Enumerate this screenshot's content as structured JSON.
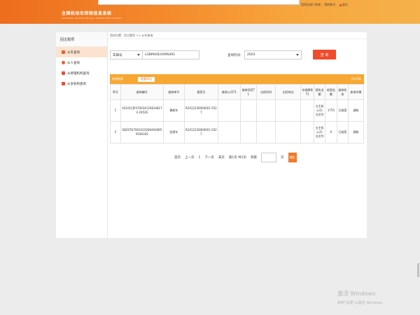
{
  "header": {
    "title": "全国机动车检验信息系统",
    "subtitle": "NATIONAL MOTOR VEHICLE INSPECTION SYSTEM",
    "links": [
      "您所在部门系统",
      "我的账号",
      "退出"
    ]
  },
  "sidebar": {
    "heading": "回主题项",
    "items": [
      {
        "label": "从车查询",
        "icon": "car-icon",
        "color": "#e8622b",
        "active": true
      },
      {
        "label": "从人查询",
        "icon": "person-icon",
        "color": "#e8622b"
      },
      {
        "label": "从修理机构查询",
        "icon": "wrench-icon",
        "color": "#f04b2c"
      },
      {
        "label": "从多机构查询",
        "icon": "building-icon",
        "color": "#f04b2c"
      }
    ]
  },
  "breadcrumb": "您的位置：回主题项 >> 从车查询",
  "search": {
    "type_value": "车辆号",
    "vin_value": "LGBM4AE4XMS491",
    "date_label": "查询时间：",
    "year_value": "2024",
    "query_label": "查 询"
  },
  "panel": {
    "title": "查询结果",
    "export_label": "批量导出",
    "right_label": "共计2条"
  },
  "table": {
    "columns": [
      "序号",
      "维修编号",
      "维修单号",
      "报案号",
      "维修公司T1",
      "维修项目T1",
      "出险时间",
      "出险地点",
      "车辆属性T1",
      "损失金额",
      "结案金额",
      "维修状态",
      "查询详情"
    ],
    "rows": [
      [
        "1",
        "VS101CJP3700241208148174 26526",
        "事故车",
        "R2412230000001 0527",
        "",
        "",
        "",
        "",
        "",
        "五主机公司-五名华",
        "1755",
        "已结案",
        "调取"
      ],
      [
        "2",
        "SD0CP37002412006491895 9180342",
        "定损车",
        "R2412230000001 0527",
        "",
        "",
        "",
        "",
        "",
        "五主机公司-五名华",
        "0",
        "已结案",
        "调取"
      ]
    ]
  },
  "pager": {
    "first": "首页",
    "prev": "上一页",
    "page": "1",
    "next": "下一页",
    "last": "末页",
    "info": "第1页 共1页",
    "jump_label": "到第",
    "page_unit": "页",
    "go": "确定"
  },
  "watermark": {
    "line1": "激活 Windows",
    "line2": "转到\"设置\"以激活 Windows。"
  },
  "colors": {
    "header_start": "#ed6d1d",
    "panel_bar": "#f7a733",
    "query_button": "#f04b2c"
  }
}
